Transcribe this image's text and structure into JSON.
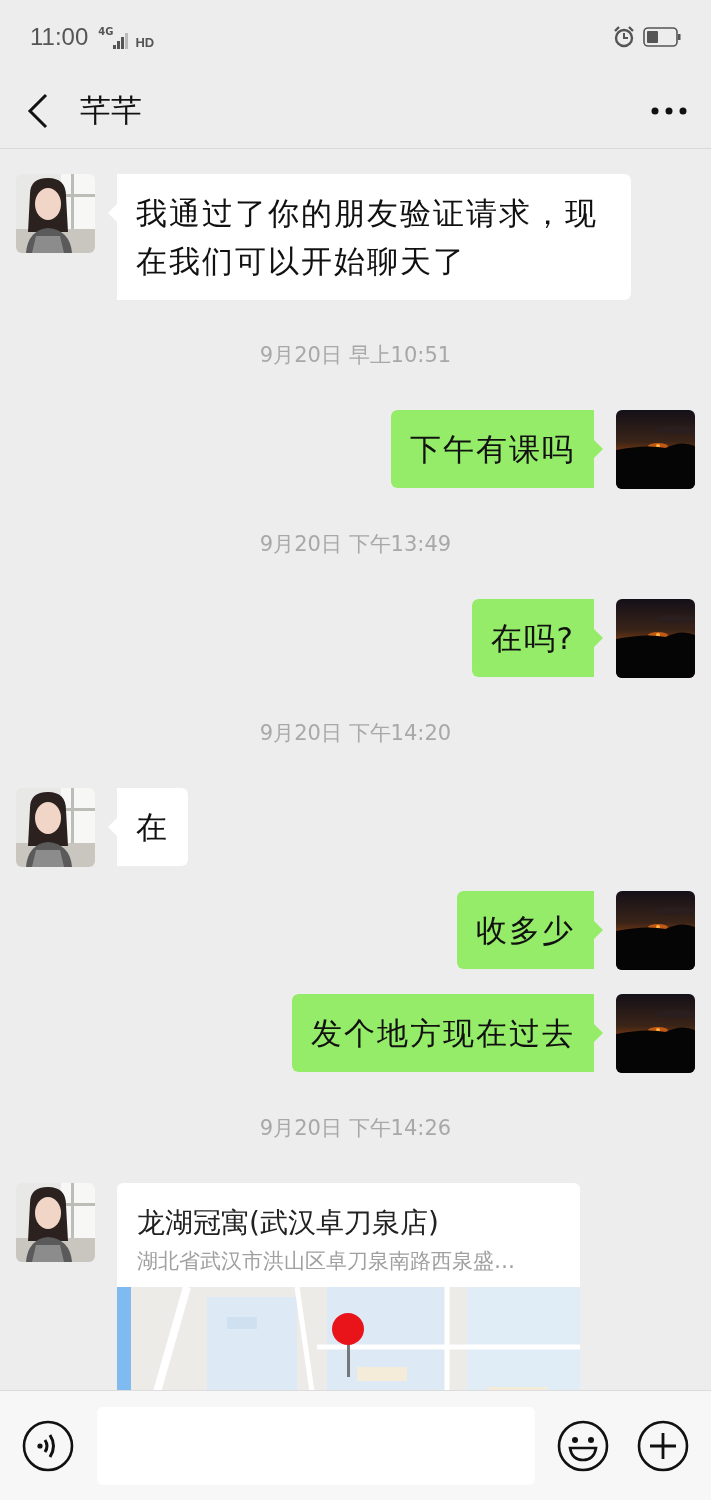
{
  "status_bar": {
    "time": "11:00",
    "network": "4G",
    "hd": "HD"
  },
  "header": {
    "title": "芊芊"
  },
  "messages": [
    {
      "kind": "text",
      "outgoing": false,
      "text": "我通过了你的朋友验证请求，现在我们可以开始聊天了"
    },
    {
      "kind": "time",
      "text": "9月20日 早上10:51"
    },
    {
      "kind": "text",
      "outgoing": true,
      "text": "下午有课吗"
    },
    {
      "kind": "time",
      "text": "9月20日 下午13:49"
    },
    {
      "kind": "text",
      "outgoing": true,
      "text": "在吗?"
    },
    {
      "kind": "time",
      "text": "9月20日 下午14:20"
    },
    {
      "kind": "text",
      "outgoing": false,
      "text": "在"
    },
    {
      "kind": "text",
      "outgoing": true,
      "text": "收多少"
    },
    {
      "kind": "text",
      "outgoing": true,
      "text": "发个地方现在过去"
    },
    {
      "kind": "time",
      "text": "9月20日 下午14:26"
    },
    {
      "kind": "location",
      "outgoing": false,
      "title": "龙湖冠寓(武汉卓刀泉店)",
      "address": "湖北省武汉市洪山区卓刀泉南路西泉盛…"
    }
  ]
}
